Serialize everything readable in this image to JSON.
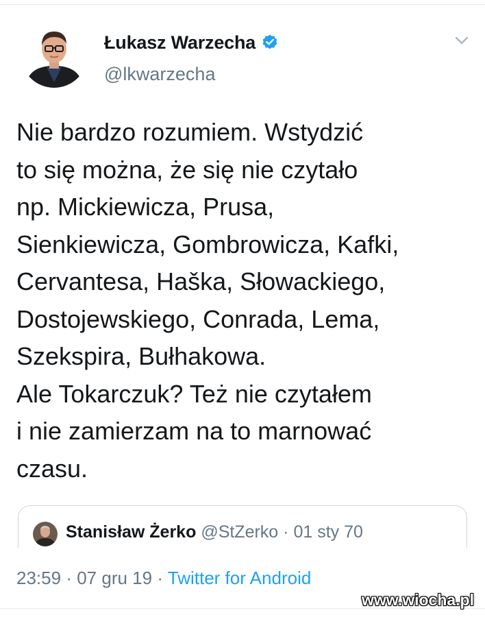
{
  "tweet": {
    "author": {
      "name": "Łukasz Warzecha",
      "handle": "@lkwarzecha",
      "verified": true,
      "avatar_icon": "profile-photo"
    },
    "text_lines": [
      "Nie bardzo rozumiem. Wstydzić",
      "to się można, że się nie czytało",
      "np. Mickiewicza, Prusa,",
      "Sienkiewicza, Gombrowicza, Kafki,",
      "Cervantesa, Haška, Słowackiego,",
      "Dostojewskiego, Conrada, Lema,",
      "Szekspira, Bułhakowa.",
      "Ale Tokarczuk? Też nie czytałem",
      "i nie zamierzam na to marnować",
      "czasu."
    ],
    "quoted": {
      "name": "Stanisław Żerko",
      "handle": "@StZerko",
      "separator": "·",
      "date": "01 sty 70"
    },
    "meta": {
      "time": "23:59",
      "separator": "·",
      "date": "07 gru 19",
      "source": "Twitter for Android"
    }
  },
  "watermark": "www.wiocha.pl",
  "colors": {
    "text": "#14171a",
    "secondary": "#657786",
    "link": "#1da1f2",
    "verified": "#1da1f2",
    "border": "#ccd6dd"
  }
}
